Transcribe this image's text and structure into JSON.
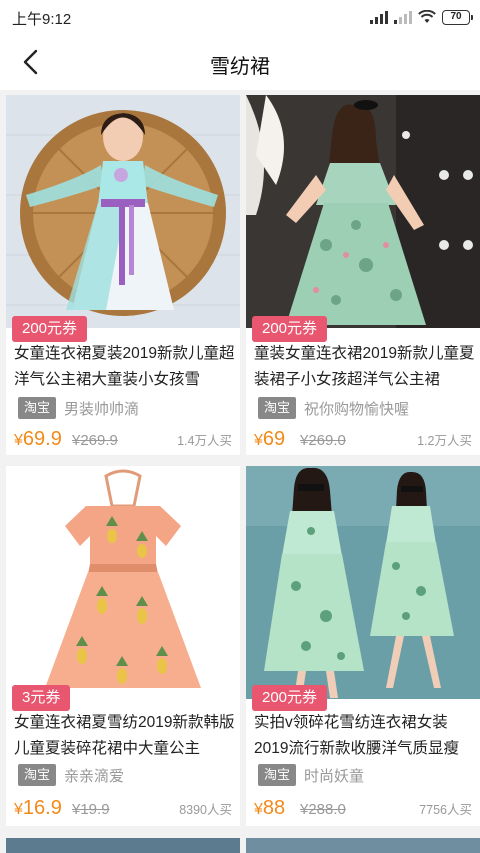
{
  "status": {
    "time": "上午9:12",
    "battery": "70",
    "icons": [
      "signal-icon",
      "signal-weak-icon",
      "wifi-icon",
      "battery-icon"
    ]
  },
  "nav": {
    "back_icon": "chevron-left-icon",
    "title": "雪纺裙"
  },
  "colors": {
    "coupon": "#e8566f",
    "price": "#f28a1a",
    "tag": "#888888"
  },
  "products": [
    {
      "coupon": "200元券",
      "title": "女童连衣裙夏装2019新款儿童超洋气公主裙大童装小女孩雪",
      "platform": "淘宝",
      "shop": "男装帅帅滴",
      "price": "69.9",
      "currency": "¥",
      "original_price": "¥269.9",
      "sales": "1.4万人买"
    },
    {
      "coupon": "200元券",
      "title": "童装女童连衣裙2019新款儿童夏装裙子小女孩超洋气公主裙",
      "platform": "淘宝",
      "shop": "祝你购物愉快喔",
      "price": "69",
      "currency": "¥",
      "original_price": "¥269.0",
      "sales": "1.2万人买"
    },
    {
      "coupon": "3元券",
      "title": "女童连衣裙夏雪纺2019新款韩版儿童夏装碎花裙中大童公主",
      "platform": "淘宝",
      "shop": "亲亲滴爱",
      "price": "16.9",
      "currency": "¥",
      "original_price": "¥19.9",
      "sales": "8390人买"
    },
    {
      "coupon": "200元券",
      "title": "实拍v领碎花雪纺连衣裙女装2019流行新款收腰洋气质显瘦",
      "platform": "淘宝",
      "shop": "时尚妖童",
      "price": "88",
      "currency": "¥",
      "original_price": "¥288.0",
      "sales": "7756人买"
    }
  ]
}
